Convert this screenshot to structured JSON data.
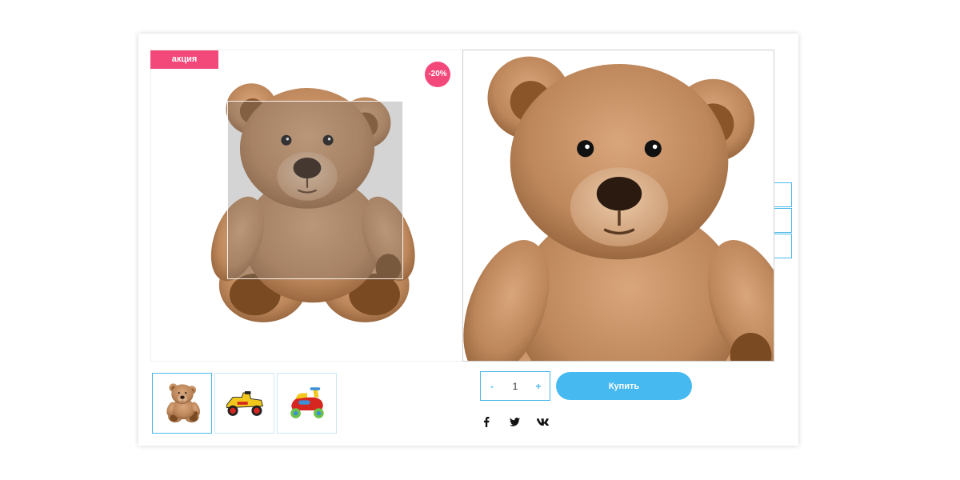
{
  "product": {
    "sale_badge": "акция",
    "discount_badge": "-20%",
    "thumbnails": [
      {
        "icon": "teddy-bear-thumbnail",
        "active": true
      },
      {
        "icon": "toy-car-thumbnail",
        "active": false
      },
      {
        "icon": "ride-on-toy-thumbnail",
        "active": false
      }
    ],
    "quantity": {
      "minus": "-",
      "value": "1",
      "plus": "+"
    },
    "buy_label": "Купить",
    "social": [
      {
        "icon": "facebook-icon",
        "label": "f"
      },
      {
        "icon": "twitter-icon",
        "label": "t"
      },
      {
        "icon": "vk-icon",
        "label": "vk"
      }
    ]
  },
  "colors": {
    "accent": "#46b9f0",
    "badge": "#f3487a",
    "bear_fur": "#c08a5e",
    "bear_dark": "#7a4a22"
  }
}
